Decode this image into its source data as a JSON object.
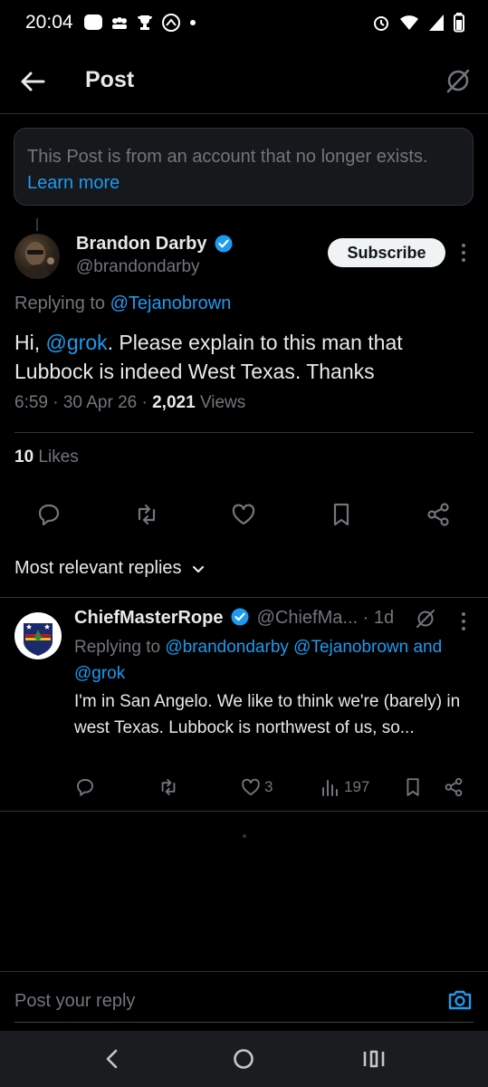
{
  "status_bar": {
    "time": "20:04"
  },
  "header": {
    "title": "Post"
  },
  "notice": {
    "text": "This Post is from an account that no longer exists.",
    "link": "Learn more"
  },
  "post": {
    "author_name": "Brandon Darby",
    "handle": "@brandondarby",
    "subscribe_label": "Subscribe",
    "replying_prefix": "Replying to",
    "replying_to": "@Tejanobrown",
    "text_prefix": "Hi,",
    "mention": "@grok",
    "text_suffix": ". Please explain to this man that Lubbock is indeed West Texas. Thanks",
    "time": "6:59 · 30 Apr 26 ·",
    "views_count": "2,021",
    "views_label": "Views",
    "likes_count": "10",
    "likes_label": "Likes"
  },
  "sort": {
    "label": "Most relevant replies"
  },
  "reply": {
    "author_name": "ChiefMasterRope",
    "handle": "@ChiefMa...",
    "age": "· 1d",
    "replying_prefix": "Replying to",
    "replying_to_1": "@brandondarby",
    "replying_to_2": "@Tejanobrown",
    "and_label": "and",
    "replying_to_3": "@grok",
    "text": "I'm in San Angelo. We like to think we're (barely) in west Texas. Lubbock is northwest of us, so...",
    "likes": "3",
    "views": "197"
  },
  "compose": {
    "placeholder": "Post your reply"
  },
  "colors": {
    "accent": "#1d9bf0",
    "background": "#000000",
    "muted": "#71767b"
  }
}
